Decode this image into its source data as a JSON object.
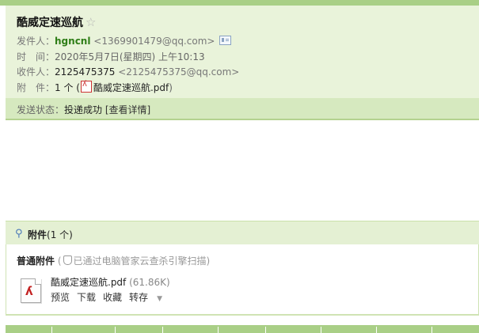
{
  "subject": "酷威定速巡航",
  "star_icon": "star-outline-icon",
  "sender": {
    "label": "发件人：",
    "name": "hgncnl",
    "email": "<1369901479@qq.com>"
  },
  "time": {
    "label": "时　间：",
    "value": "2020年5月7日(星期四) 上午10:13"
  },
  "recipient": {
    "label": "收件人：",
    "name": "2125475375",
    "email": "<2125475375@qq.com>"
  },
  "attachment_line": {
    "label": "附　件：",
    "count": "1 个 (",
    "file": "酷威定速巡航.pdf",
    "close": ")"
  },
  "status": {
    "label": "发送状态：",
    "value": "投递成功",
    "details": "[查看详情]"
  },
  "attachments": {
    "header_title": "附件",
    "header_count": "(1 个)",
    "normal_label": "普通附件",
    "scan_note_open": "(",
    "scan_note": "已通过电脑管家云查杀引擎扫描)",
    "file": {
      "name": "酷威定速巡航.pdf",
      "size": "(61.86K)",
      "actions": [
        "预览",
        "下载",
        "收藏",
        "转存"
      ]
    }
  },
  "colors": {
    "header_bg": "#e9f3da",
    "status_bg": "#d6e9bf",
    "accent_green": "#a9cf86",
    "sender_green": "#2e7d16"
  }
}
